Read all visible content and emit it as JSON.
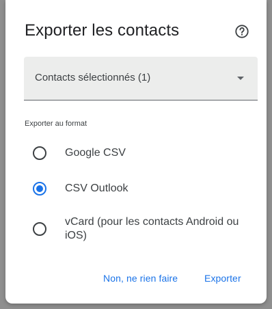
{
  "dialog": {
    "title": "Exporter les contacts",
    "help_icon": "help-circle-icon"
  },
  "selection": {
    "value": "Contacts sélectionnés (1)"
  },
  "format": {
    "label": "Exporter au format",
    "options": [
      {
        "label": "Google CSV",
        "checked": false
      },
      {
        "label": "CSV Outlook",
        "checked": true
      },
      {
        "label": "vCard (pour les contacts Android ou iOS)",
        "checked": false
      }
    ]
  },
  "actions": {
    "cancel_label": "Non, ne rien faire",
    "export_label": "Exporter"
  },
  "colors": {
    "accent": "#1a73e8",
    "select_bg": "#ecedec"
  }
}
